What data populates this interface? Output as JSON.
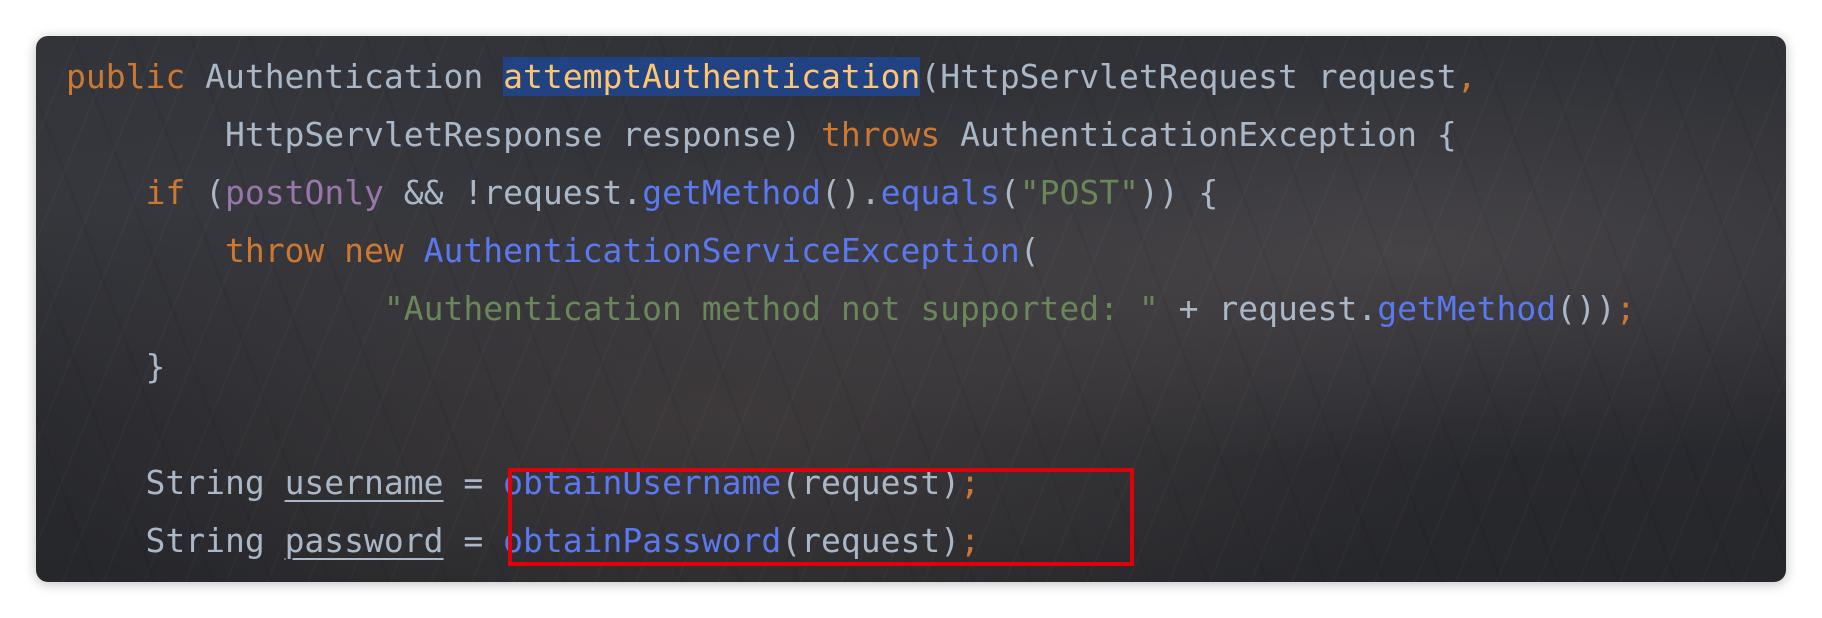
{
  "code_lines": [
    {
      "indent": "",
      "tokens": [
        {
          "text": "public",
          "kind": "kw"
        },
        {
          "text": " Authentication ",
          "kind": "plain"
        },
        {
          "text": "attemptAuthentication",
          "kind": "hl-method"
        },
        {
          "text": "(HttpServletRequest request",
          "kind": "plain"
        },
        {
          "text": ",",
          "kind": "punc"
        }
      ]
    },
    {
      "indent": "        ",
      "tokens": [
        {
          "text": "HttpServletResponse response) ",
          "kind": "plain"
        },
        {
          "text": "throws",
          "kind": "kw"
        },
        {
          "text": " AuthenticationException {",
          "kind": "plain"
        }
      ]
    },
    {
      "indent": "    ",
      "tokens": [
        {
          "text": "if",
          "kind": "kw"
        },
        {
          "text": " (",
          "kind": "plain"
        },
        {
          "text": "postOnly",
          "kind": "field"
        },
        {
          "text": " && !request.",
          "kind": "plain"
        },
        {
          "text": "getMethod",
          "kind": "call"
        },
        {
          "text": "().",
          "kind": "plain"
        },
        {
          "text": "equals",
          "kind": "call"
        },
        {
          "text": "(",
          "kind": "plain"
        },
        {
          "text": "\"POST\"",
          "kind": "str"
        },
        {
          "text": ")) {",
          "kind": "plain"
        }
      ]
    },
    {
      "indent": "        ",
      "tokens": [
        {
          "text": "throw",
          "kind": "kw"
        },
        {
          "text": " ",
          "kind": "plain"
        },
        {
          "text": "new",
          "kind": "kw"
        },
        {
          "text": " ",
          "kind": "plain"
        },
        {
          "text": "AuthenticationServiceException",
          "kind": "call"
        },
        {
          "text": "(",
          "kind": "plain"
        }
      ]
    },
    {
      "indent": "                ",
      "tokens": [
        {
          "text": "\"Authentication method not supported: \"",
          "kind": "str"
        },
        {
          "text": " + request.",
          "kind": "plain"
        },
        {
          "text": "getMethod",
          "kind": "call"
        },
        {
          "text": "())",
          "kind": "plain"
        },
        {
          "text": ";",
          "kind": "punc"
        }
      ]
    },
    {
      "indent": "    ",
      "tokens": [
        {
          "text": "}",
          "kind": "plain"
        }
      ]
    },
    {
      "indent": "",
      "tokens": []
    },
    {
      "indent": "    ",
      "tokens": [
        {
          "text": "String ",
          "kind": "plain"
        },
        {
          "text": "username",
          "kind": "var"
        },
        {
          "text": " = ",
          "kind": "plain"
        },
        {
          "text": "obtainUsername",
          "kind": "call"
        },
        {
          "text": "(request)",
          "kind": "plain"
        },
        {
          "text": ";",
          "kind": "punc"
        }
      ]
    },
    {
      "indent": "    ",
      "tokens": [
        {
          "text": "String ",
          "kind": "plain"
        },
        {
          "text": "password",
          "kind": "var"
        },
        {
          "text": " = ",
          "kind": "plain"
        },
        {
          "text": "obtainPassword",
          "kind": "call"
        },
        {
          "text": "(request)",
          "kind": "plain"
        },
        {
          "text": ";",
          "kind": "punc"
        }
      ]
    }
  ],
  "colors": {
    "keyword": "#cc7832",
    "field": "#9876aa",
    "method_call": "#5a78f0",
    "string": "#6a8759",
    "plain": "#a9b7c6",
    "selected_method": "#ffc66d",
    "selection_background": "#214283",
    "annotation_box": "#e0000a"
  }
}
